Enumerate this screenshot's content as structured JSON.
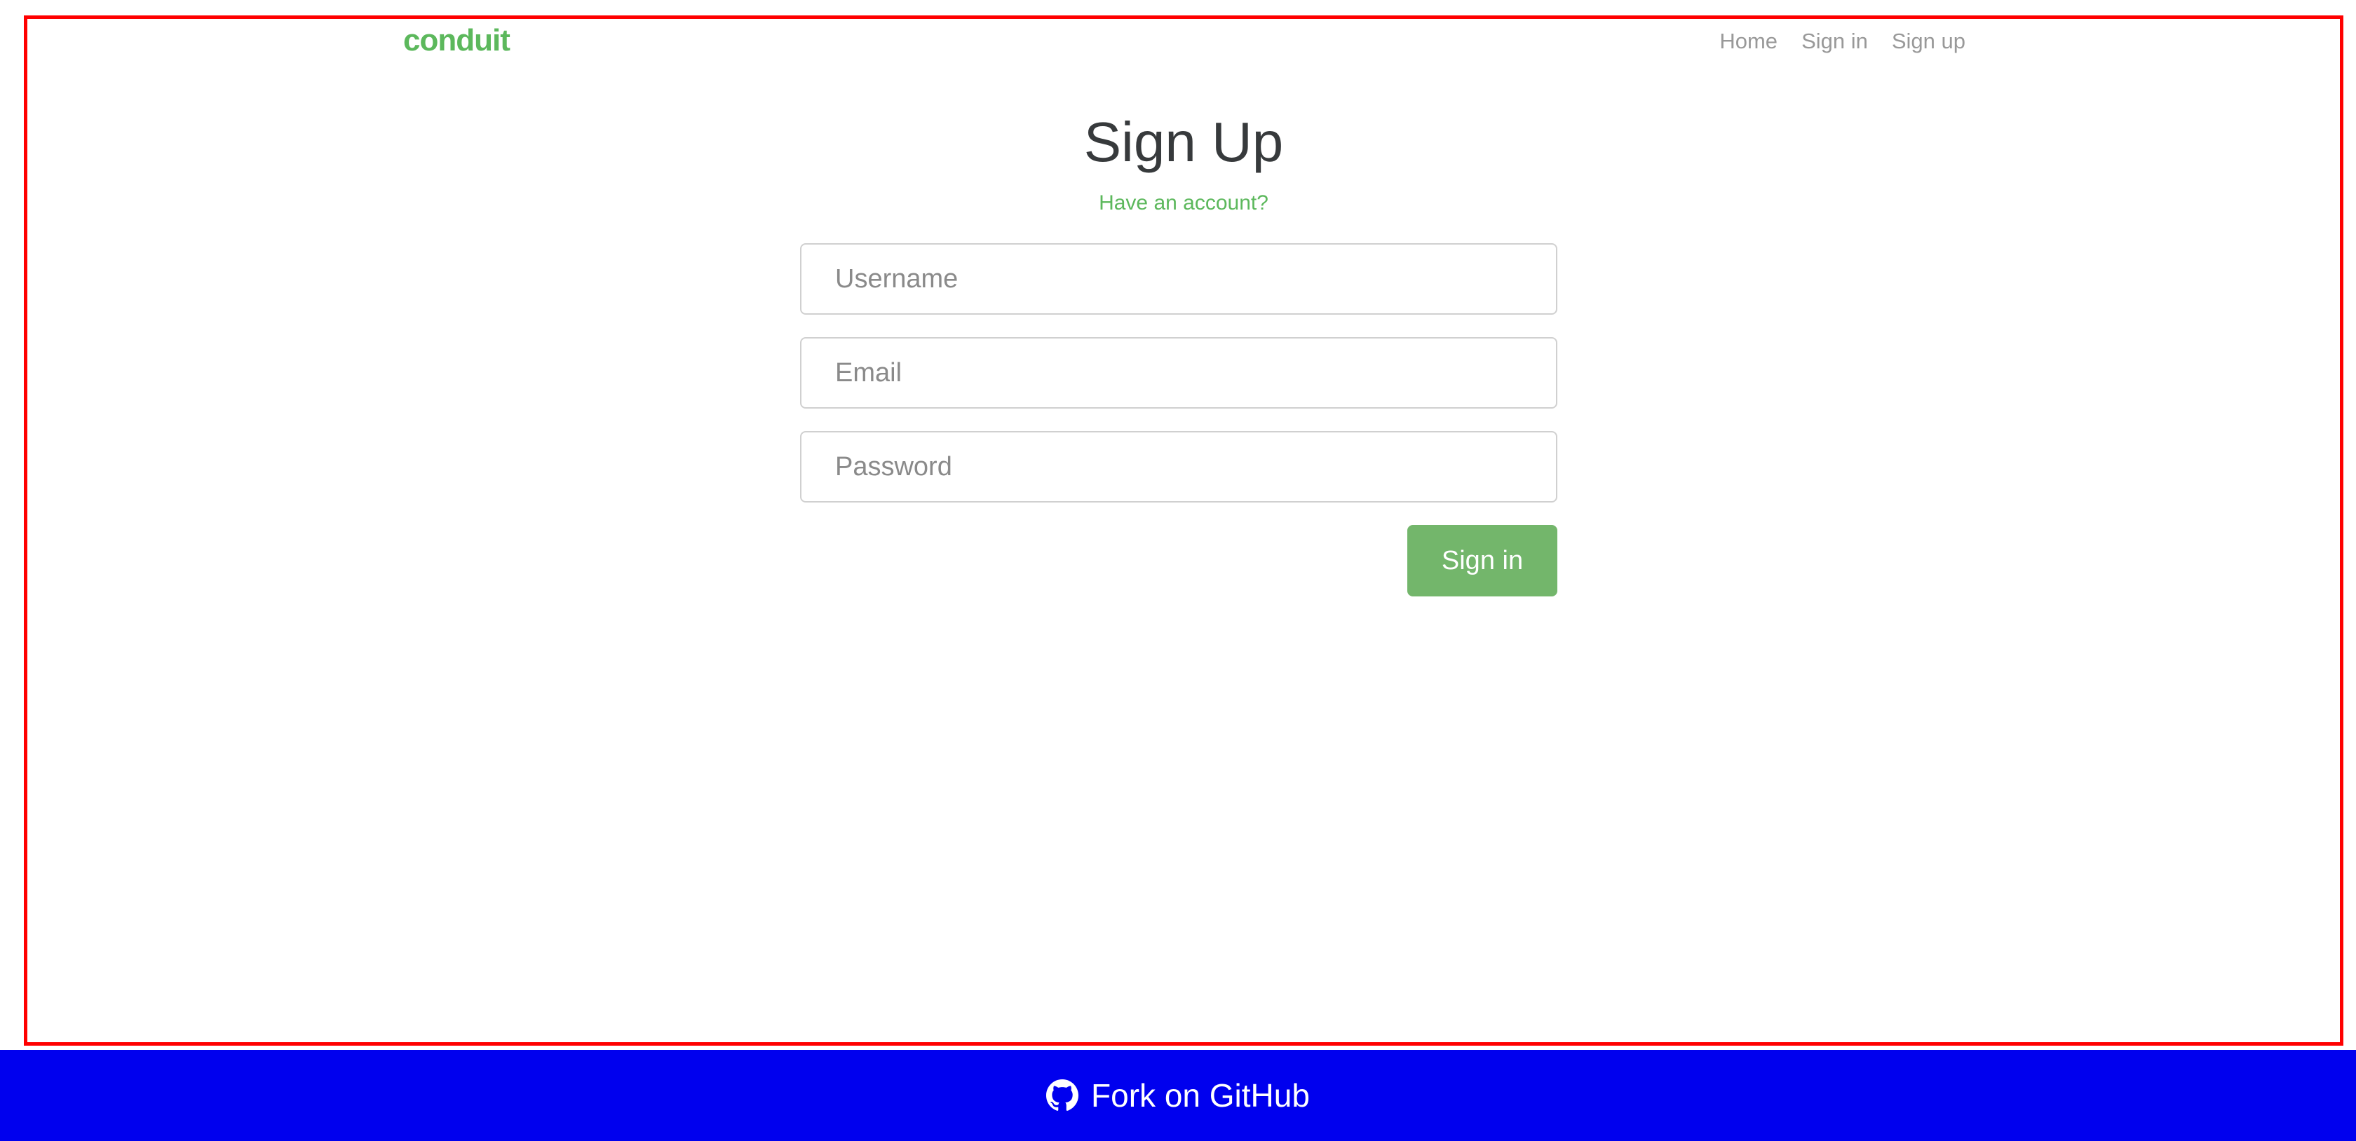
{
  "navbar": {
    "brand": "conduit",
    "links": [
      "Home",
      "Sign in",
      "Sign up"
    ]
  },
  "auth": {
    "title": "Sign Up",
    "have_account_link": "Have an account?",
    "username_placeholder": "Username",
    "email_placeholder": "Email",
    "password_placeholder": "Password",
    "submit_label": "Sign in"
  },
  "footer": {
    "icon": "github-icon",
    "label": "Fork on GitHub"
  },
  "colors": {
    "brand": "#5cb85c",
    "submit_bg": "#73b66b",
    "footer_bg": "#0000ee",
    "highlight_border": "#ff0000"
  }
}
